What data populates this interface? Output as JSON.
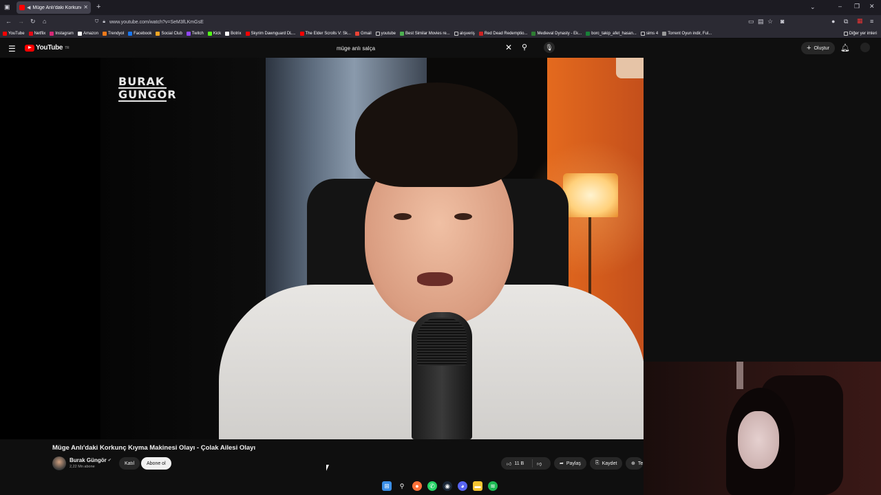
{
  "browser": {
    "tab_title": "Müge Anlı'daki Korkunç Kıyma",
    "url": "www.youtube.com/watch?v=SeM3fLKmGsE",
    "bookmarks": [
      {
        "label": "YouTube",
        "color": "#ff0000"
      },
      {
        "label": "Netflix",
        "color": "#e50914"
      },
      {
        "label": "Instagram",
        "color": "#d62976"
      },
      {
        "label": "Amazon",
        "color": "#ffffff"
      },
      {
        "label": "Trendyol",
        "color": "#f27a1a"
      },
      {
        "label": "Facebook",
        "color": "#1877f2"
      },
      {
        "label": "Social Club",
        "color": "#f5a623"
      },
      {
        "label": "Twitch",
        "color": "#9146ff"
      },
      {
        "label": "Kick",
        "color": "#53fc18"
      },
      {
        "label": "Botrix",
        "color": "#ffffff"
      },
      {
        "label": "Skyrim Dawnguard DL...",
        "color": "#ff0000"
      },
      {
        "label": "The Elder Scrolls V: Sk...",
        "color": "#ff0000"
      },
      {
        "label": "Gmail",
        "color": "#ea4335"
      },
      {
        "label": "youtube",
        "color": "#cccccc"
      },
      {
        "label": "Best Similar Movies re...",
        "color": "#4caf50"
      },
      {
        "label": "alışveriş",
        "color": "#cccccc"
      },
      {
        "label": "Red Dead Redemptio...",
        "color": "#cc2222"
      },
      {
        "label": "Medieval Dynasty - Ek...",
        "color": "#2e7d32"
      },
      {
        "label": "borc_takip_afet_hasan...",
        "color": "#188038"
      },
      {
        "label": "sims 4",
        "color": "#cccccc"
      },
      {
        "label": "Torrent Oyun indir, Ful...",
        "color": "#999999"
      }
    ],
    "other_bookmarks": "Diğer yer imleri"
  },
  "youtube": {
    "logo_text": "YouTube",
    "logo_region": "TR",
    "search_value": "müge anlı salça",
    "create_label": "Oluştur"
  },
  "video": {
    "overlay_logo_line1": "BURAK",
    "overlay_logo_line2": "GUNGOR",
    "title": "Müge Anlı'daki Korkunç Kıyma Makinesi Olayı - Çolak Ailesi Olayı",
    "channel_name": "Burak Güngör",
    "subscribers": "2,22 Mn abone",
    "join_label": "Katıl",
    "subscribe_label": "Abone ol",
    "likes": "11 B",
    "share_label": "Paylaş",
    "save_label": "Kaydet",
    "more_label": "Te"
  }
}
